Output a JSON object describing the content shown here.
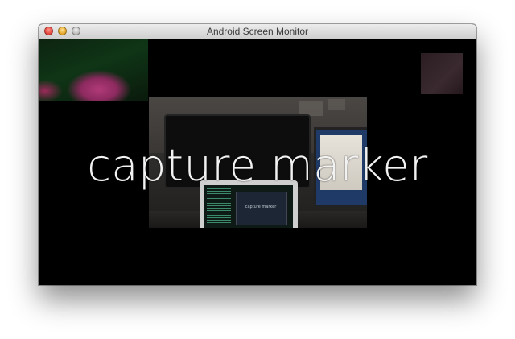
{
  "window": {
    "title": "Android Screen Monitor"
  },
  "screen": {
    "overlay_text": "capture marker",
    "photo_caption": "capture marker"
  },
  "colors": {
    "screen_background": "#000000",
    "overlay_text": "#f2f2f2",
    "close_button": "#e0443a",
    "minimize_button": "#e1a223",
    "zoom_button": "#b8b8b8"
  },
  "icons": {
    "close": "close-icon",
    "minimize": "minimize-icon",
    "zoom": "zoom-icon"
  }
}
